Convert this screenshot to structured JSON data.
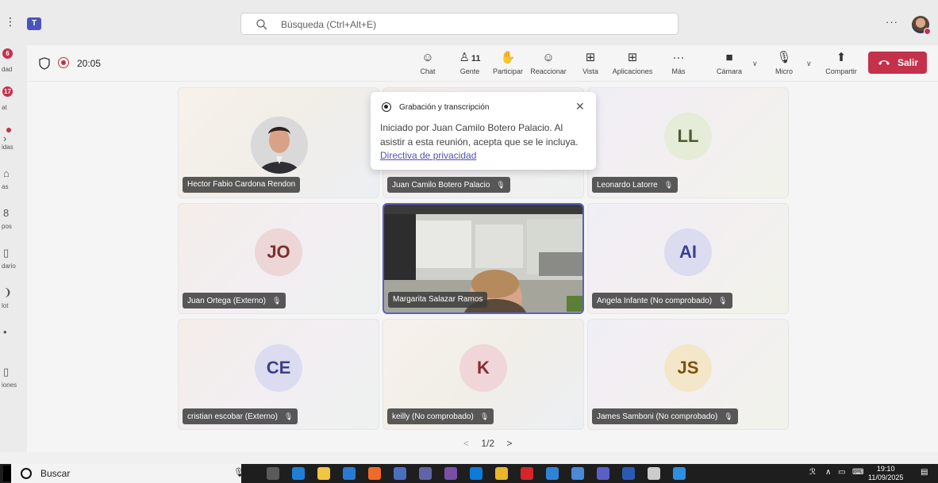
{
  "titlebar": {
    "menu_glyph": "⋮",
    "app_logo_glyph": "T",
    "search_placeholder": "Búsqueda (Ctrl+Alt+E)",
    "more_glyph": "···"
  },
  "rail": [
    {
      "label": "dad",
      "badge": "6"
    },
    {
      "label": "at",
      "badge": "17"
    },
    {
      "label": "idas",
      "dot": true
    },
    {
      "label": "as"
    },
    {
      "label": "pos"
    },
    {
      "label": "dario"
    },
    {
      "label": "lot"
    },
    {
      "label": ""
    },
    {
      "label": "iones"
    }
  ],
  "meeting": {
    "timer": "20:05",
    "gente_count": "11",
    "toolbar": {
      "chat": "Chat",
      "gente": "Gente",
      "participar": "Participar",
      "reaccionar": "Reaccionar",
      "vista": "Vista",
      "aplicaciones": "Aplicaciones",
      "mas": "Más",
      "camara": "Cámara",
      "micro": "Micro",
      "compartir": "Compartir",
      "salir": "Salir"
    },
    "popup": {
      "title": "Grabación y transcripción",
      "body": "Iniciado por Juan Camilo Botero Palacio. Al asistir a esta reunión, acepta que se le incluya.",
      "link": "Directiva de privacidad",
      "close": "✕"
    },
    "tiles": [
      {
        "name": "Hector Fabio Cardona Rendon",
        "initials": "",
        "photo": true,
        "muted": false
      },
      {
        "name": "Juan Camilo Botero Palacio",
        "initials": "",
        "muted": true
      },
      {
        "name": "Leonardo Latorre",
        "initials": "LL",
        "color": "#e5ecd8",
        "text": "#4c5a2e",
        "muted": true
      },
      {
        "name": "Juan Ortega (Externo)",
        "initials": "JO",
        "color": "#ecd6d6",
        "text": "#7a2f2f",
        "muted": true
      },
      {
        "name": "Margarita Salazar Ramos",
        "initials": "",
        "video": true,
        "muted": false
      },
      {
        "name": "Angela Infante (No comprobado)",
        "initials": "AI",
        "color": "#dcdcf0",
        "text": "#3b3f8c",
        "muted": true
      },
      {
        "name": "cristian escobar (Externo)",
        "initials": "CE",
        "color": "#dcdcf0",
        "text": "#3b3f8c",
        "muted": true
      },
      {
        "name": "keilly (No comprobado)",
        "initials": "K",
        "color": "#f0d6d8",
        "text": "#8a2a30",
        "muted": true
      },
      {
        "name": "James Samboni (No comprobado)",
        "initials": "JS",
        "color": "#f4e6c8",
        "text": "#7a5310",
        "muted": true
      }
    ],
    "pager": {
      "prev": "<",
      "label": "1/2",
      "next": ">"
    }
  },
  "taskbar": {
    "search_label": "Buscar",
    "clock_time": "19:10",
    "clock_date": "11/09/2025",
    "apps": [
      {
        "name": "task-view",
        "color": "#5a5a5a"
      },
      {
        "name": "edge",
        "color": "#1d7fd6"
      },
      {
        "name": "file-explorer",
        "color": "#f2c443"
      },
      {
        "name": "store",
        "color": "#2a7ad5"
      },
      {
        "name": "firefox",
        "color": "#f06a2a"
      },
      {
        "name": "app-blue",
        "color": "#4a6fc1"
      },
      {
        "name": "app-teams-classic",
        "color": "#6264a7"
      },
      {
        "name": "app-cortana",
        "color": "#7a4fa7"
      },
      {
        "name": "mail",
        "color": "#0c7bd8"
      },
      {
        "name": "chrome",
        "color": "#e8b52c"
      },
      {
        "name": "opera",
        "color": "#d7262a"
      },
      {
        "name": "app-draw",
        "color": "#2f82d8"
      },
      {
        "name": "app-linux",
        "color": "#4a8ad6"
      },
      {
        "name": "teams",
        "color": "#5b5fc7"
      },
      {
        "name": "word",
        "color": "#2b5ab3"
      },
      {
        "name": "settings",
        "color": "#cccccc"
      },
      {
        "name": "app-store-blue",
        "color": "#2e8ee0"
      }
    ]
  }
}
